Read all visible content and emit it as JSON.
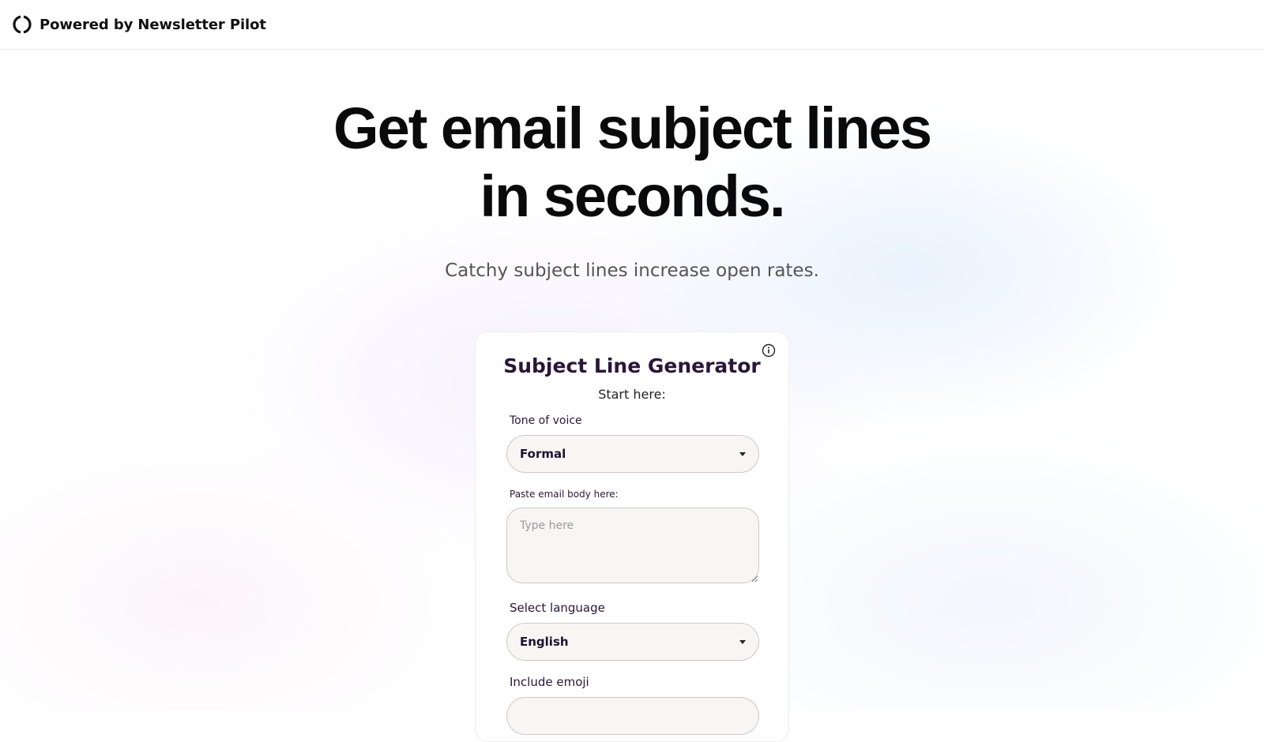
{
  "header": {
    "brand_text": "Powered by Newsletter Pilot",
    "logo_icon": "ring-logo-icon"
  },
  "hero": {
    "title": "Get email subject lines in seconds.",
    "subtitle": "Catchy subject lines increase open rates."
  },
  "card": {
    "title": "Subject Line Generator",
    "subtitle": "Start here:",
    "info_icon": "info-icon",
    "tone": {
      "label": "Tone of voice",
      "value": "Formal"
    },
    "email_body": {
      "label": "Paste email body here:",
      "placeholder": "Type here",
      "value": ""
    },
    "language": {
      "label": "Select language",
      "value": "English"
    },
    "emoji": {
      "label": "Include emoji"
    }
  },
  "colors": {
    "card_title": "#2a1638",
    "field_bg": "#f8f6f3",
    "field_border": "#cfc8c8"
  }
}
